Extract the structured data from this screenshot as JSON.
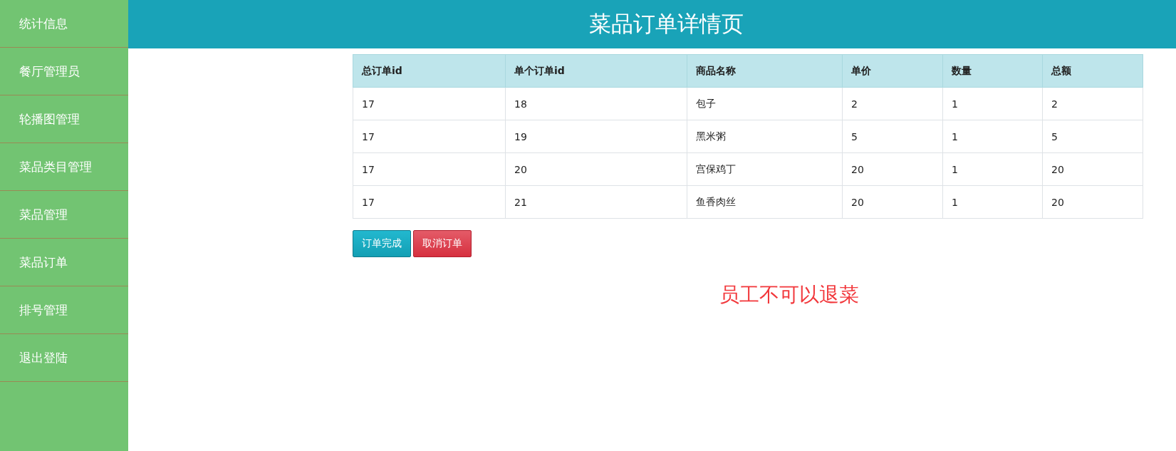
{
  "sidebar": {
    "items": [
      {
        "label": "统计信息",
        "selected": false
      },
      {
        "label": "餐厅管理员",
        "selected": false
      },
      {
        "label": "轮播图管理",
        "selected": false
      },
      {
        "label": "菜品类目管理",
        "selected": false
      },
      {
        "label": "菜品管理",
        "selected": false
      },
      {
        "label": "菜品订单",
        "selected": false
      },
      {
        "label": "排号管理",
        "selected": false
      },
      {
        "label": "退出登陆",
        "selected": false
      }
    ]
  },
  "header": {
    "title": "菜品订单详情页"
  },
  "table": {
    "columns": [
      "总订单id",
      "单个订单id",
      "商品名称",
      "单价",
      "数量",
      "总额"
    ],
    "rows": [
      [
        "17",
        "18",
        "包子",
        "2",
        "1",
        "2"
      ],
      [
        "17",
        "19",
        "黑米粥",
        "5",
        "1",
        "5"
      ],
      [
        "17",
        "20",
        "宫保鸡丁",
        "20",
        "1",
        "20"
      ],
      [
        "17",
        "21",
        "鱼香肉丝",
        "20",
        "1",
        "20"
      ]
    ]
  },
  "buttons": [
    {
      "label": "订单完成",
      "kind": "info"
    },
    {
      "label": "取消订单",
      "kind": "danger"
    }
  ],
  "notice": "员工不可以退菜"
}
